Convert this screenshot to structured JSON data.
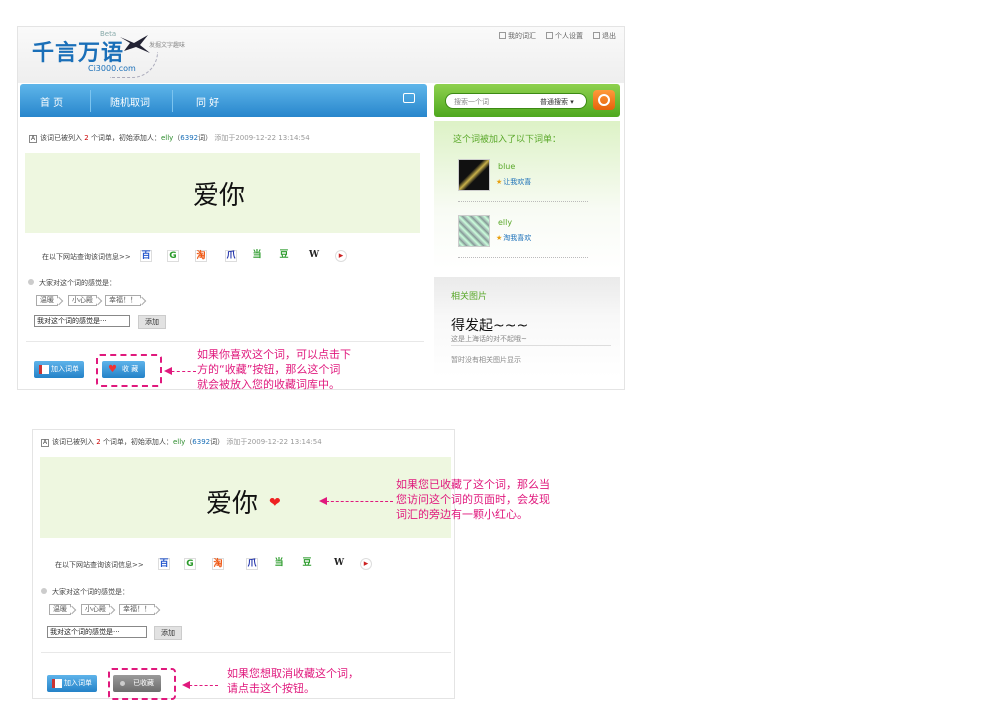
{
  "header": {
    "logo_text": "千言万语",
    "logo_beta": "Beta",
    "logo_domain": "Ci3000.com",
    "slogan": "发掘文字趣味",
    "links": [
      "我的词汇",
      "个人设置",
      "退出"
    ]
  },
  "nav": {
    "items": [
      "首 页",
      "随机取词",
      "同 好"
    ]
  },
  "search": {
    "placeholder": "搜索一个词",
    "mode": "普通搜索 ▾"
  },
  "word_info": {
    "prefix": "该词已被列入",
    "count": "2",
    "mid": "个词单，初始添加人：",
    "user": "elly",
    "open_paren": "（",
    "user_count": "6392",
    "close_paren": "词）",
    "added_at": "添加于2009-12-22 13:14:54"
  },
  "word": "爱你",
  "heart": "❤",
  "sites_label": "在以下网站查询该词信息>>",
  "sites": [
    "百",
    "G",
    "淘",
    "爪",
    "当",
    "豆",
    "W",
    "▸"
  ],
  "feelings": {
    "label": "大家对这个词的感觉是：",
    "tags": [
      "温暖",
      "小心殿",
      "幸福！！"
    ],
    "input_value": "我对这个词的感觉是···",
    "add_label": "添加"
  },
  "buttons": {
    "add_to_list": "加入词单",
    "favorite": "收 藏",
    "favorited": "已收藏"
  },
  "sidebar": {
    "lists_title": "这个词被加入了以下词单：",
    "lists": [
      {
        "user": "blue",
        "name": "让我欢喜"
      },
      {
        "user": "elly",
        "name": "淘我喜欢"
      }
    ],
    "pictures_title": "相关图片",
    "phrase": "得发起~~~",
    "phrase_note": "这是上海话的对不起哦~",
    "no_pictures": "暂时没有相关图片显示"
  },
  "notes": {
    "note1": [
      "如果你喜欢这个词，可以点击下",
      "方的“收藏”按钮，那么这个词",
      "就会被放入您的收藏词库中。"
    ],
    "note2": [
      "如果您已收藏了这个词，那么当",
      "您访问这个词的页面时，会发现",
      "词汇的旁边有一颗小红心。"
    ],
    "note3": [
      "如果您想取消收藏这个词，",
      "请点击这个按钮。"
    ]
  }
}
